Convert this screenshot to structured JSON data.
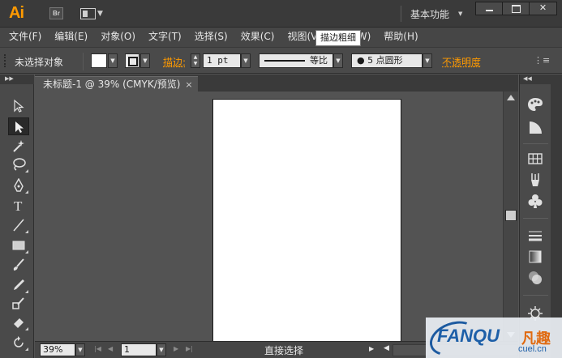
{
  "titlebar": {
    "app_logo": "Ai",
    "bridge_button": "Br",
    "workspace": "基本功能",
    "window_buttons": {
      "minimize": "",
      "maximize": "",
      "close": "✕"
    }
  },
  "menubar": {
    "items": [
      {
        "label": "文件(F)"
      },
      {
        "label": "编辑(E)"
      },
      {
        "label": "对象(O)"
      },
      {
        "label": "文字(T)"
      },
      {
        "label": "选择(S)"
      },
      {
        "label": "效果(C)"
      },
      {
        "label": "视图(V)"
      },
      {
        "label": "窗口(W)"
      },
      {
        "label": "帮助(H)"
      }
    ],
    "tooltip": "描边粗细"
  },
  "controlbar": {
    "selection_label": "未选择对象",
    "stroke_label": "描边:",
    "stroke_weight": "1 pt",
    "profile_label": "等比",
    "brush_label": "●  5 点圆形",
    "opacity_label": "不透明度",
    "colors": {
      "fill": "#ffffff",
      "stroke": "#1a1a1a",
      "accent": "#ff9a00"
    }
  },
  "document": {
    "tab_title": "未标题-1 @ 39% (CMYK/预览)",
    "tab_close": "×"
  },
  "statusbar": {
    "zoom": "39%",
    "page": "1",
    "status_text": "直接选择"
  },
  "tools": [
    {
      "name": "selection-tool-icon"
    },
    {
      "name": "direct-selection-tool-icon",
      "active": true
    },
    {
      "name": "magic-wand-tool-icon"
    },
    {
      "name": "lasso-tool-icon"
    },
    {
      "name": "pen-tool-icon"
    },
    {
      "name": "type-tool-icon",
      "glyph": "T"
    },
    {
      "name": "line-segment-tool-icon"
    },
    {
      "name": "rectangle-tool-icon"
    },
    {
      "name": "paintbrush-tool-icon"
    },
    {
      "name": "pencil-tool-icon"
    },
    {
      "name": "blob-brush-tool-icon"
    },
    {
      "name": "eraser-tool-icon"
    },
    {
      "name": "rotate-tool-icon"
    }
  ],
  "dock": [
    {
      "name": "color-panel-icon"
    },
    {
      "name": "color-guide-panel-icon"
    },
    {
      "name": "swatches-panel-icon"
    },
    {
      "name": "brushes-panel-icon"
    },
    {
      "name": "symbols-panel-icon"
    },
    {
      "name": "stroke-panel-icon"
    },
    {
      "name": "gradient-panel-icon"
    },
    {
      "name": "transparency-panel-icon"
    },
    {
      "name": "appearance-panel-icon"
    }
  ],
  "watermark": {
    "brand": "FANQU",
    "brand_cn": "凡趣",
    "url": "cuel.cn"
  }
}
